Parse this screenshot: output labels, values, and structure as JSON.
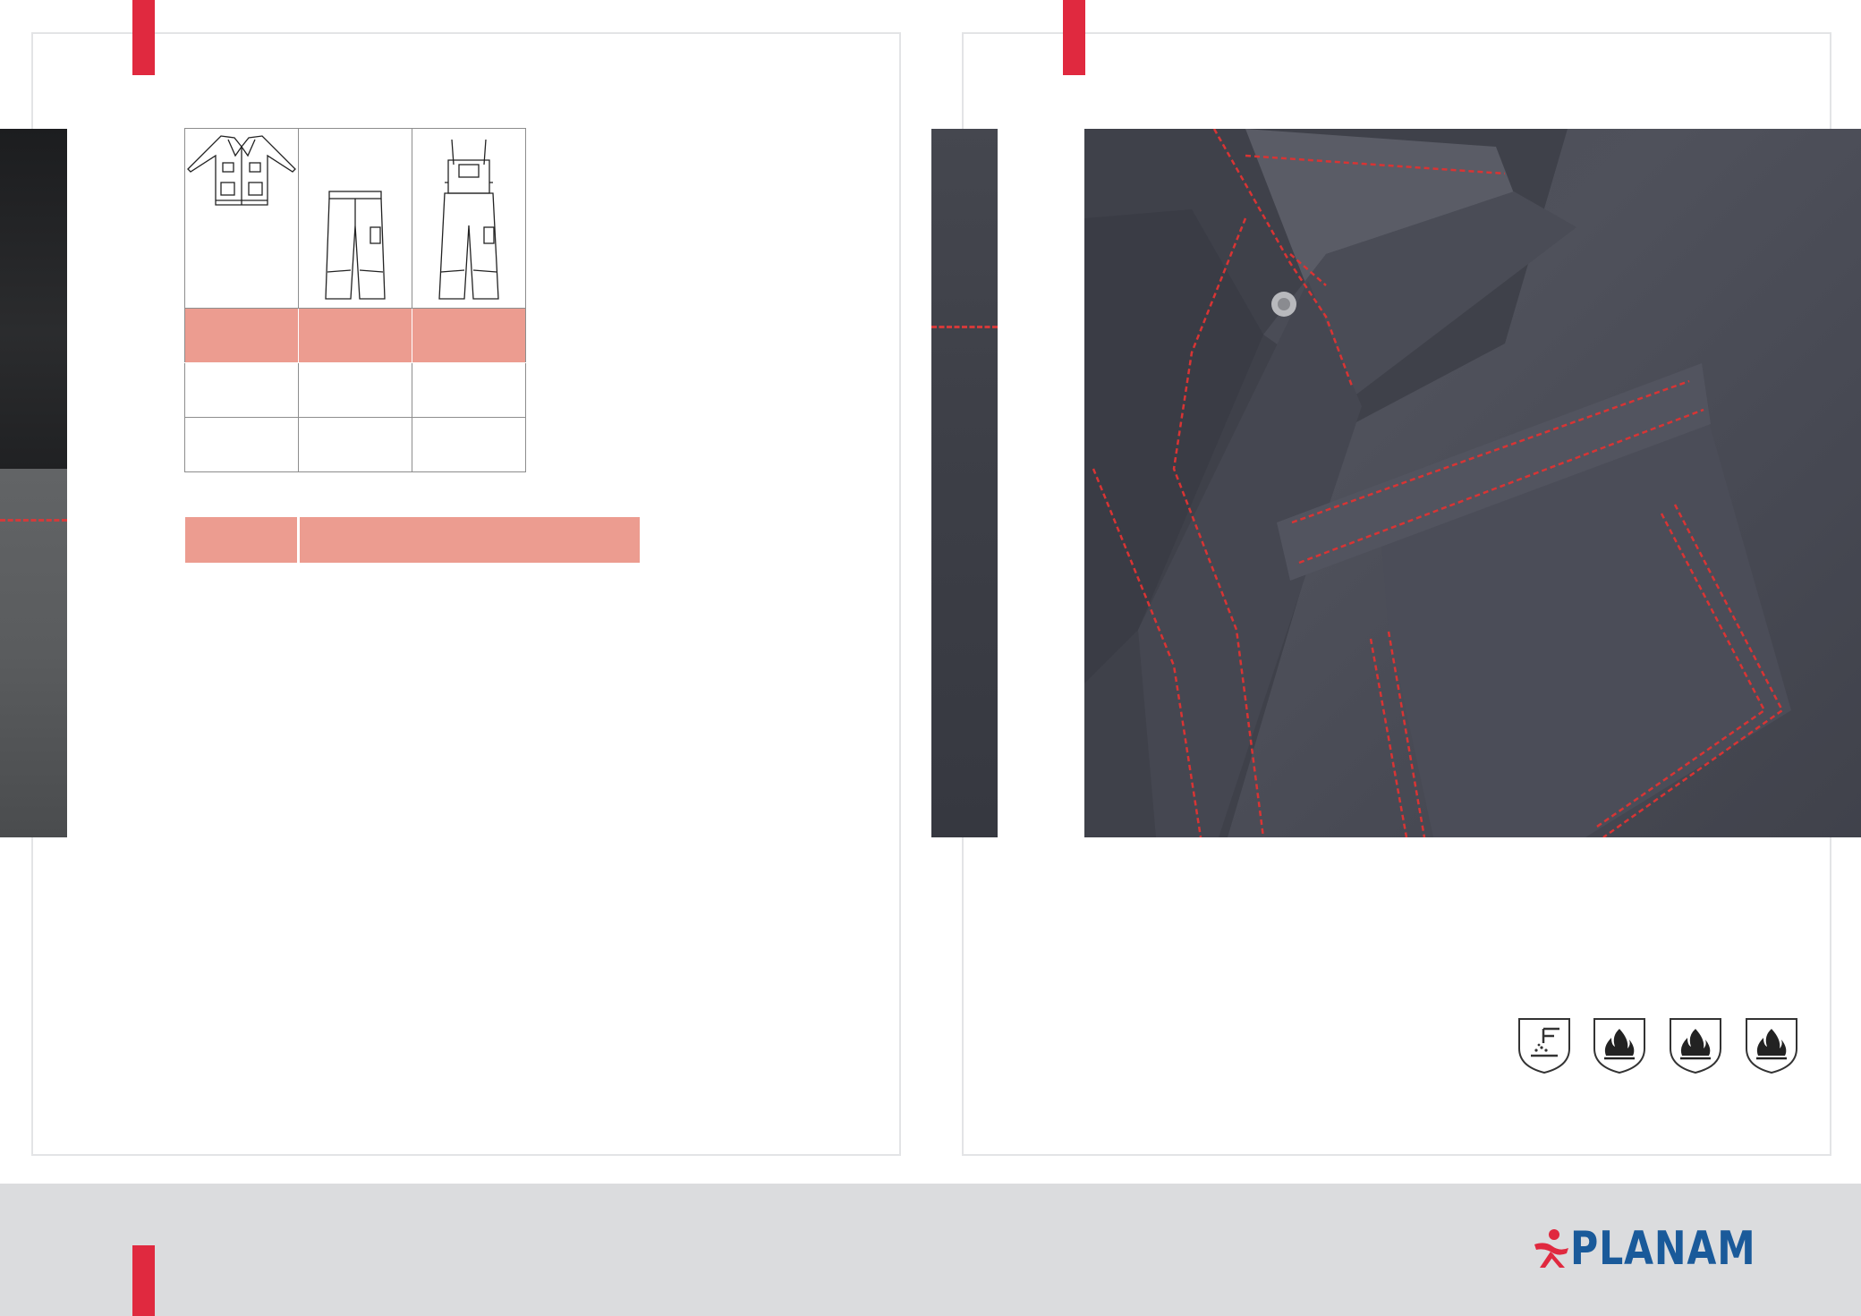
{
  "brand": {
    "name": "PLANAM",
    "logo_text": "PLANAM",
    "colors": {
      "accent_red": "#e0293f",
      "swatch_salmon": "#ec9c90",
      "logo_blue": "#1a5a9a",
      "footer_gray": "#dbdcde"
    }
  },
  "product_table": {
    "items": [
      {
        "icon": "jacket-icon"
      },
      {
        "icon": "trousers-icon"
      },
      {
        "icon": "bib-overalls-icon"
      }
    ]
  },
  "photos": [
    {
      "name": "fabric-strip-left",
      "subject": "black and grey workwear fabric with red stitching"
    },
    {
      "name": "fabric-strip-right",
      "subject": "grey workwear fabric with red stitching"
    },
    {
      "name": "jacket-closeup",
      "subject": "grey jacket collar and chest pocket with red stitching"
    }
  ],
  "safety_icons": [
    "welding-protection-icon",
    "flame-protection-icon",
    "flame-protection-icon",
    "flame-protection-icon"
  ]
}
